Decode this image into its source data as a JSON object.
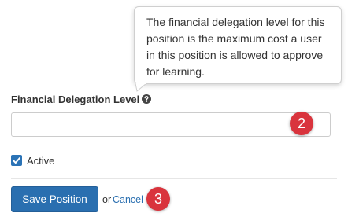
{
  "tooltip": {
    "text": "The financial delegation level for this position is the maximum cost a user in this position is allowed to approve for learning."
  },
  "form": {
    "financial_delegation_label": "Financial Delegation Level",
    "financial_delegation_value": "",
    "active_label": "Active",
    "active_checked": true
  },
  "actions": {
    "save_label": "Save Position",
    "or_text": "or",
    "cancel_label": "Cancel"
  },
  "annotations": {
    "step_2": "2",
    "step_3": "3"
  },
  "colors": {
    "primary": "#2a6fb0",
    "badge": "#d9343d"
  },
  "icons": {
    "help": "question-circle-icon",
    "check": "check-icon"
  }
}
